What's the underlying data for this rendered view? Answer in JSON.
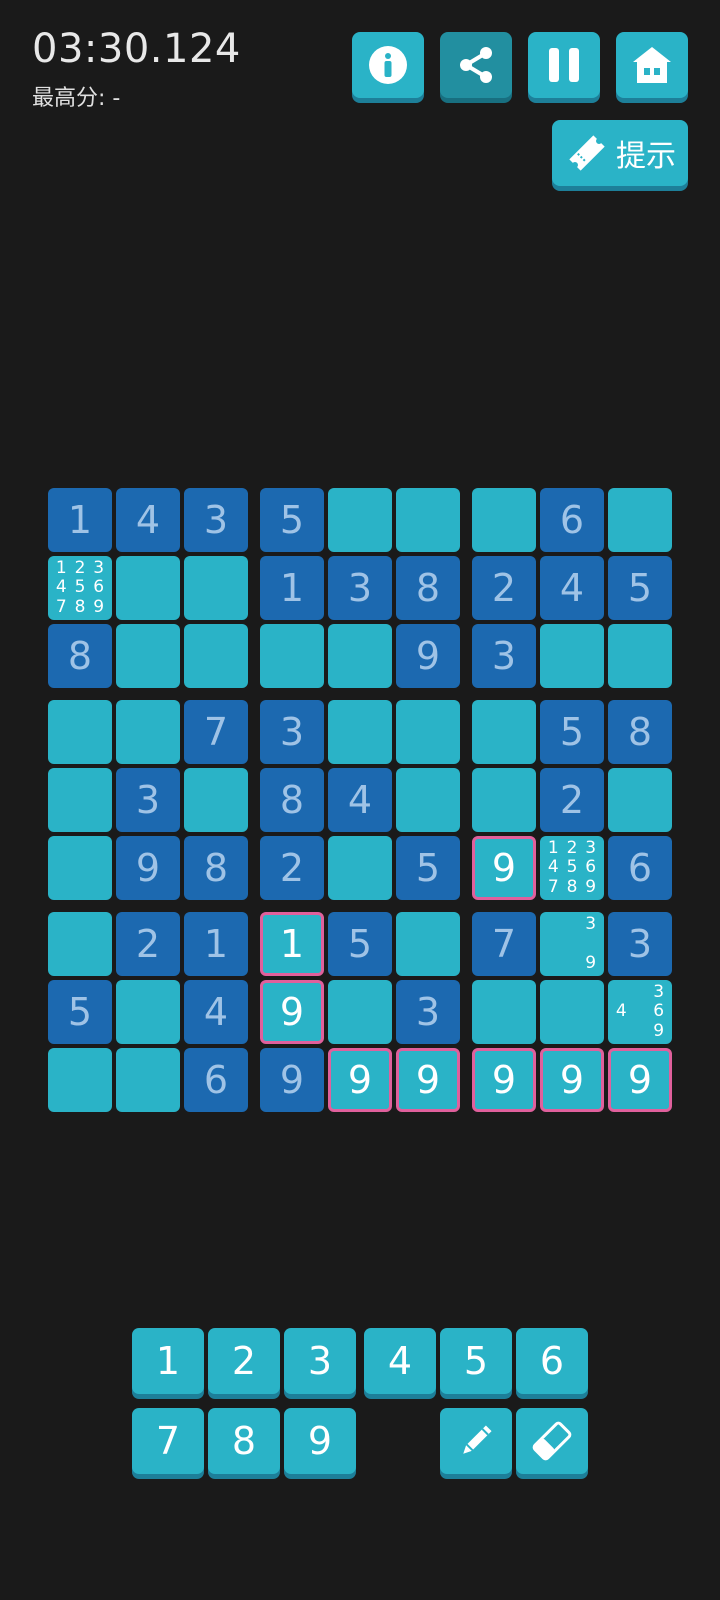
{
  "header": {
    "timer": "03:30.124",
    "best_score": "最高分: -"
  },
  "toolbar": {
    "info_icon": "info-icon",
    "share_icon": "share-icon",
    "pause_icon": "pause-icon",
    "home_icon": "home-icon",
    "hint_label": "提示",
    "hint_icon": "ticket-icon"
  },
  "board": {
    "rows": [
      [
        "1",
        "4",
        "3",
        "5",
        "",
        "",
        "",
        "6",
        ""
      ],
      [
        "",
        "",
        "",
        "1",
        "3",
        "8",
        "2",
        "4",
        "5"
      ],
      [
        "8",
        "",
        "",
        "",
        "",
        "9",
        "3",
        "",
        ""
      ],
      [
        "",
        "",
        "7",
        "3",
        "",
        "",
        "",
        "5",
        "8"
      ],
      [
        "",
        "3",
        "",
        "8",
        "4",
        "",
        "",
        "2",
        ""
      ],
      [
        "",
        "9",
        "8",
        "2",
        "",
        "5",
        "9",
        "",
        "6"
      ],
      [
        "",
        "2",
        "1",
        "1",
        "5",
        "",
        "7",
        "",
        "3"
      ],
      [
        "5",
        "",
        "4",
        "9",
        "",
        "3",
        "",
        "",
        ""
      ],
      [
        "",
        "",
        "6",
        "9",
        "9",
        "9",
        "9",
        "9",
        "9"
      ]
    ],
    "notes": {
      "1-0": [
        "1",
        "2",
        "3",
        "4",
        "5",
        "6",
        "7",
        "8",
        "9"
      ],
      "5-7": [
        "1",
        "2",
        "3",
        "4",
        "5",
        "6",
        "7",
        "8",
        "9"
      ],
      "6-7": [
        "",
        "",
        "3",
        "",
        "",
        "",
        "",
        "",
        "9"
      ],
      "7-8": [
        "",
        "",
        "3",
        "4",
        "",
        "6",
        "",
        "",
        "9"
      ]
    },
    "highlighted_cells": [
      "5-6",
      "6-3",
      "7-3",
      "8-4",
      "8-5",
      "8-6",
      "8-7",
      "8-8"
    ]
  },
  "keypad": {
    "row1": [
      "1",
      "2",
      "3",
      "4",
      "5",
      "6"
    ],
    "row2": [
      "7",
      "8",
      "9"
    ],
    "pencil_icon": "pencil-icon",
    "eraser_icon": "eraser-icon"
  },
  "colors": {
    "background": "#1a1a1a",
    "given_cell": "#1c69b0",
    "empty_cell": "#2ab3c7",
    "highlight_border": "#e0609c"
  }
}
